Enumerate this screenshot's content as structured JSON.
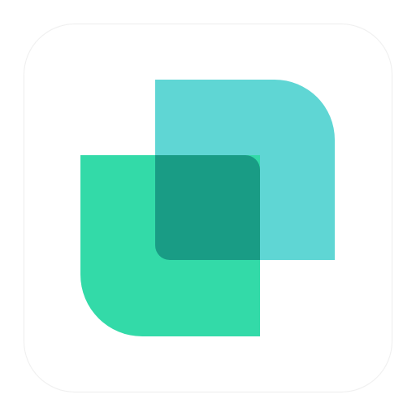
{
  "app_icon": {
    "icon_name": "overlapping-squares-logo-icon",
    "colors": {
      "background": "#ffffff",
      "back_shape": "#5fd6d4",
      "front_shape": "#33daa8",
      "overlap": "#199c85"
    }
  }
}
